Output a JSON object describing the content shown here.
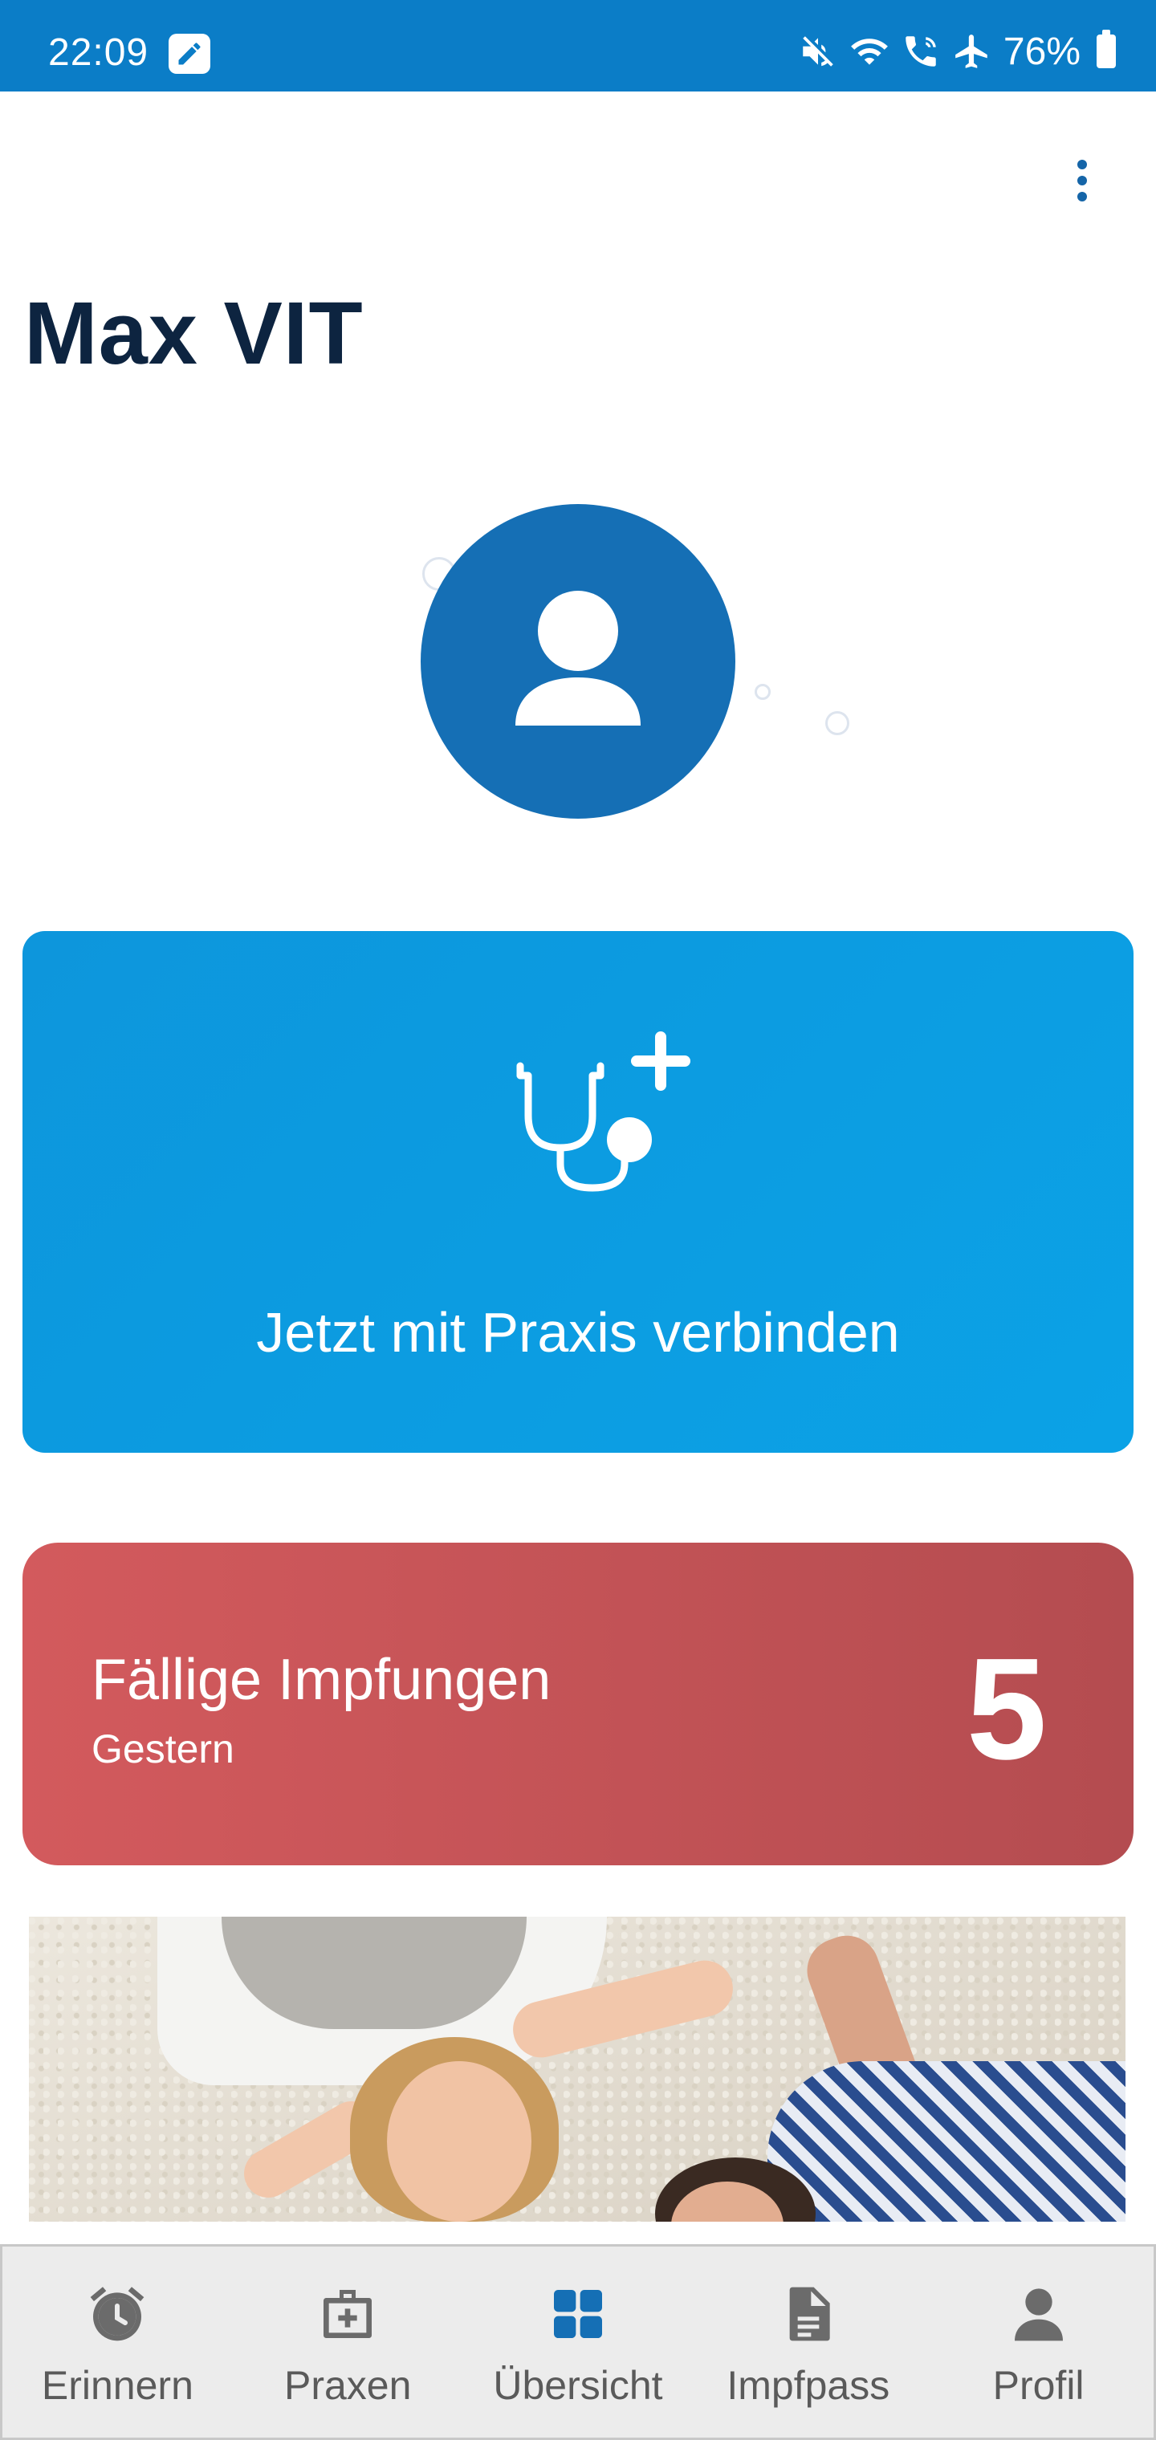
{
  "status_bar": {
    "time": "22:09",
    "battery": "76%",
    "icons": [
      "edit-icon",
      "mute-icon",
      "wifi-icon",
      "wifi-calling-icon",
      "airplane-mode-icon",
      "battery-icon"
    ]
  },
  "header": {
    "menu_icon": "more-vertical-icon",
    "title": "Max VIT"
  },
  "avatar": {
    "icon": "person-icon"
  },
  "connect_card": {
    "icon": "stethoscope-plus-icon",
    "label": "Jetzt mit Praxis verbinden",
    "color": "#0d9ddf"
  },
  "vaccination_card": {
    "title": "Fällige Impfungen",
    "subtitle": "Gestern",
    "count": "5",
    "color": "#c65356"
  },
  "bottom_nav": {
    "active": "Übersicht",
    "items": [
      {
        "label": "Erinnern",
        "icon": "alarm-clock-icon"
      },
      {
        "label": "Praxen",
        "icon": "medical-kit-icon"
      },
      {
        "label": "Übersicht",
        "icon": "dashboard-grid-icon"
      },
      {
        "label": "Impfpass",
        "icon": "document-icon"
      },
      {
        "label": "Profil",
        "icon": "person-icon"
      }
    ]
  },
  "colors": {
    "primary": "#0b7dc7",
    "avatar": "#156fb5",
    "title": "#0d2440"
  }
}
